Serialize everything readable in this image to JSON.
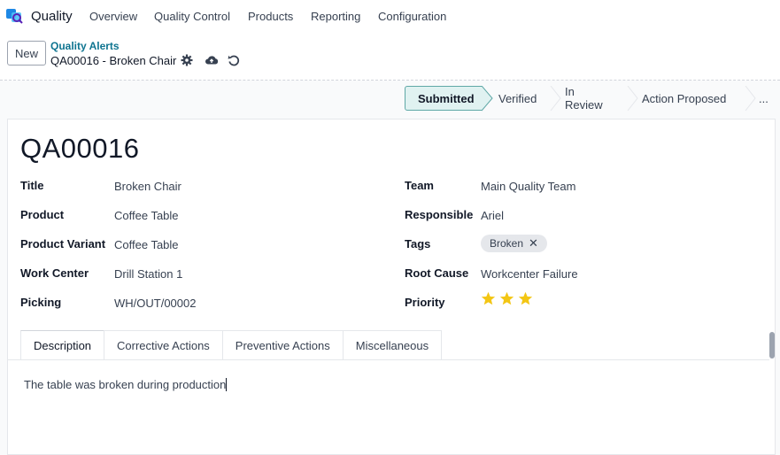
{
  "app": {
    "name": "Quality"
  },
  "nav": [
    {
      "label": "Overview"
    },
    {
      "label": "Quality Control"
    },
    {
      "label": "Products"
    },
    {
      "label": "Reporting"
    },
    {
      "label": "Configuration"
    }
  ],
  "control": {
    "new_label": "New",
    "breadcrumb": "Quality Alerts",
    "record_title": "QA00016 - Broken Chair"
  },
  "statusbar": {
    "stages": [
      "Submitted",
      "Verified",
      "In Review",
      "Action Proposed",
      "..."
    ],
    "active": "Submitted"
  },
  "record": {
    "name": "QA00016",
    "left_fields": [
      {
        "label": "Title",
        "value": "Broken Chair"
      },
      {
        "label": "Product",
        "value": "Coffee Table"
      },
      {
        "label": "Product Variant",
        "value": "Coffee Table"
      },
      {
        "label": "Work Center",
        "value": "Drill Station 1"
      },
      {
        "label": "Picking",
        "value": "WH/OUT/00002"
      }
    ],
    "right_fields": [
      {
        "label": "Team",
        "value": "Main Quality Team"
      },
      {
        "label": "Responsible",
        "value": "Ariel"
      },
      {
        "label": "Tags",
        "value": ""
      },
      {
        "label": "Root Cause",
        "value": "Workcenter Failure"
      },
      {
        "label": "Priority",
        "value": ""
      }
    ],
    "tags": [
      "Broken"
    ],
    "priority_stars": 3,
    "priority_max": 3
  },
  "tabs": [
    {
      "label": "Description"
    },
    {
      "label": "Corrective Actions"
    },
    {
      "label": "Preventive Actions"
    },
    {
      "label": "Miscellaneous"
    }
  ],
  "description": "The table was broken during production",
  "colors": {
    "accent": "#0e7490",
    "star": "#f3c614",
    "active_stage": "#e0f2f1"
  }
}
